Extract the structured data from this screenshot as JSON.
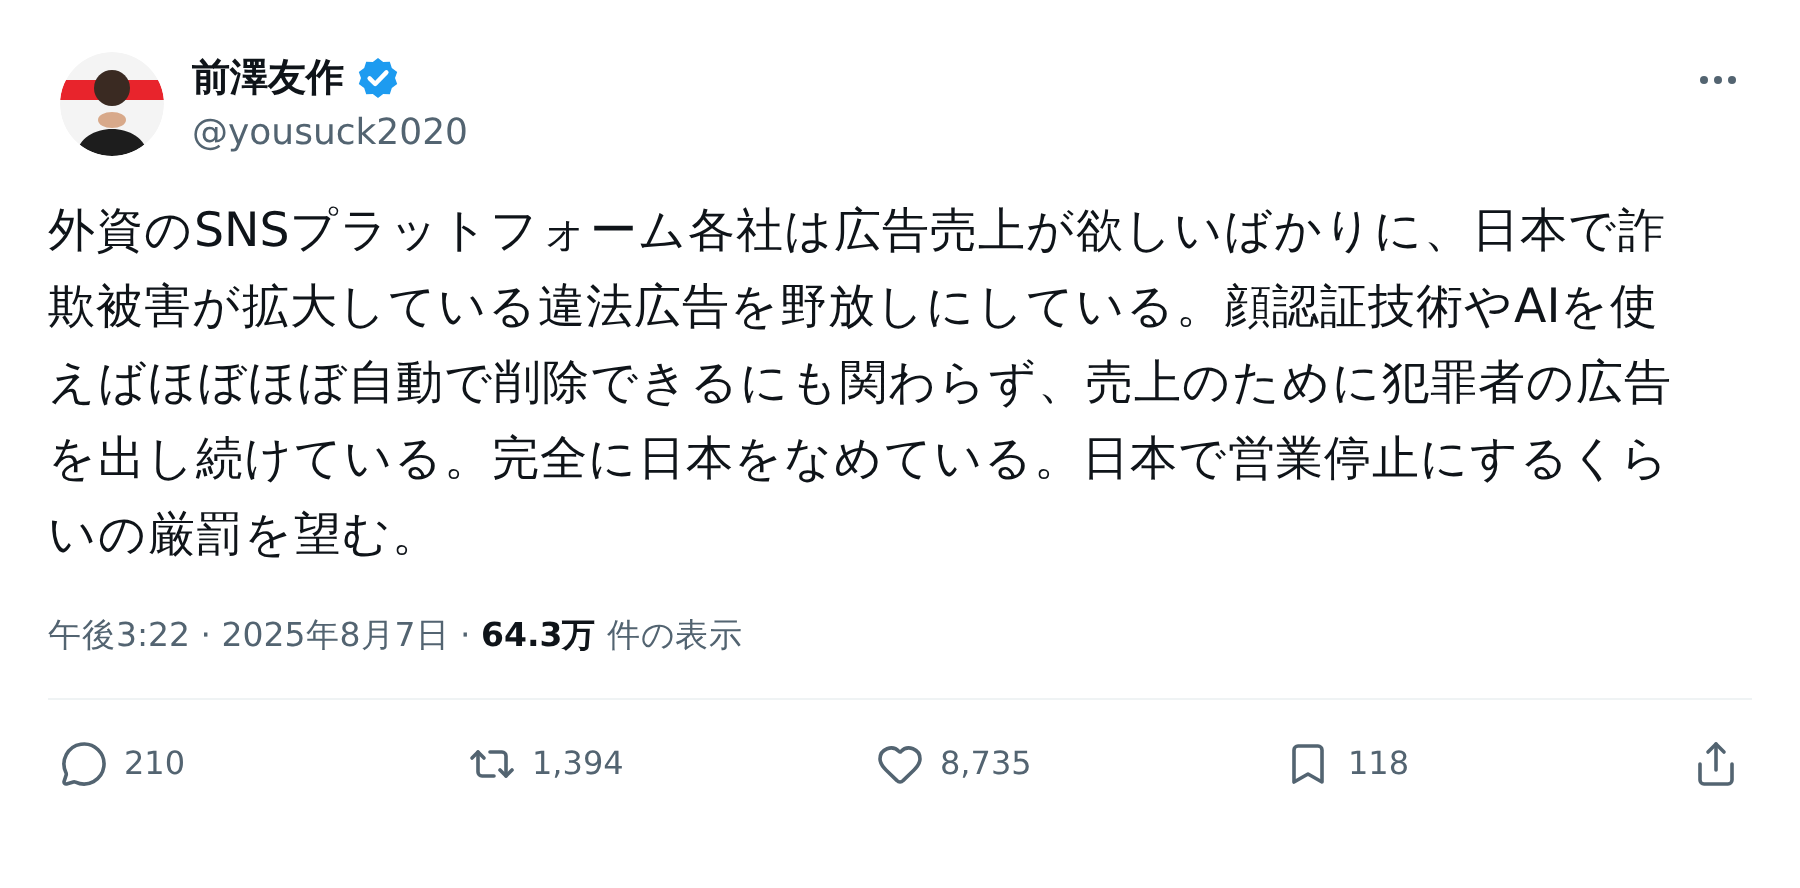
{
  "author": {
    "name": "前澤友作",
    "verified": true,
    "handle": "@yousuck2020"
  },
  "body": "外資のSNSプラットフォーム各社は広告売上が欲しいばかりに、日本で詐欺被害が拡大している違法広告を野放しにしている。顔認証技術やAIを使えばほぼほぼ自動で削除できるにも関わらず、売上のために犯罪者の広告を出し続けている。完全に日本をなめている。日本で営業停止にするくらいの厳罰を望む。",
  "meta": "午後3:22 · 2025年8月7日 · **64.3万** 件の表示",
  "actions": [
    {
      "kind": "reply",
      "count": "210"
    },
    {
      "kind": "repost",
      "count": "1,394"
    },
    {
      "kind": "like",
      "count": "8,735"
    },
    {
      "kind": "bookmark",
      "count": "118"
    },
    {
      "kind": "share"
    }
  ]
}
